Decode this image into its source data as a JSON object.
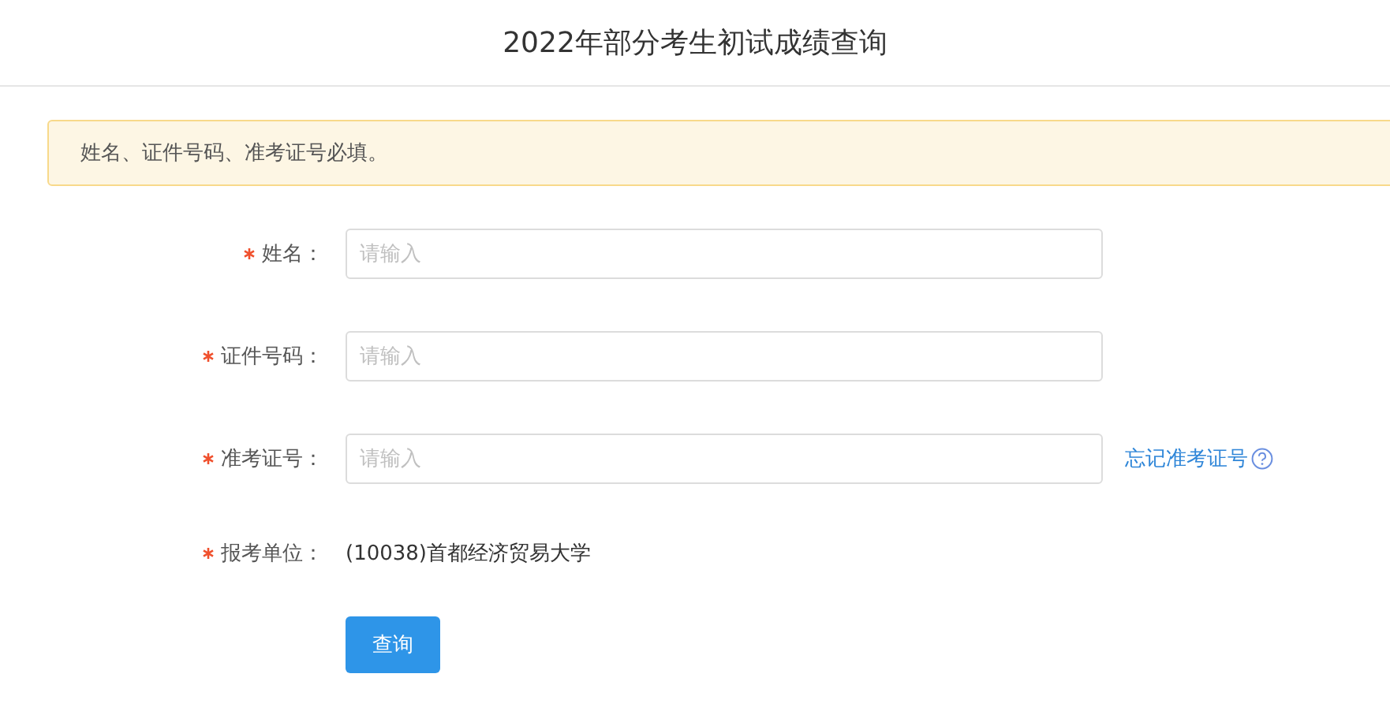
{
  "header": {
    "title": "2022年部分考生初试成绩查询"
  },
  "alert": {
    "text": "姓名、证件号码、准考证号必填。"
  },
  "form": {
    "fields": [
      {
        "kind": "input",
        "label": "姓名：",
        "required": true,
        "placeholder": "请输入"
      },
      {
        "kind": "input",
        "label": "证件号码：",
        "required": true,
        "placeholder": "请输入"
      },
      {
        "kind": "input",
        "label": "准考证号：",
        "required": true,
        "placeholder": "请输入",
        "link": "忘记准考证号"
      },
      {
        "kind": "text",
        "label": "报考单位：",
        "required": true,
        "value": "(10038)首都经济贸易大学"
      }
    ],
    "submit": "查询"
  }
}
